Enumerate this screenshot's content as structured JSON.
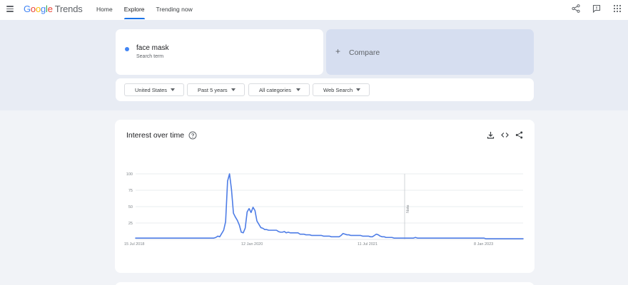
{
  "header": {
    "logo_google": "Google",
    "logo_product": "Trends",
    "nav": [
      {
        "label": "Home",
        "active": false
      },
      {
        "label": "Explore",
        "active": true
      },
      {
        "label": "Trending now",
        "active": false
      }
    ],
    "icons": [
      "share-icon",
      "feedback-icon",
      "apps-grid-icon"
    ]
  },
  "search": {
    "term": "face mask",
    "term_type": "Search term",
    "compare_label": "Compare",
    "term_color": "#4285f4"
  },
  "filters": [
    "United States",
    "Past 5 years",
    "All categories",
    "Web Search"
  ],
  "interest": {
    "title": "Interest over time",
    "actions": [
      "download-icon",
      "embed-icon",
      "share-icon"
    ],
    "note_label": "Note"
  },
  "chart_data": {
    "type": "line",
    "series": [
      {
        "values": [
          2,
          2,
          2,
          2,
          2,
          2,
          2,
          2,
          2,
          2,
          2,
          2,
          2,
          2,
          2,
          2,
          2,
          2,
          2,
          2,
          2,
          2,
          2,
          2,
          2,
          2,
          2,
          2,
          2,
          2,
          2,
          2,
          2,
          2,
          2,
          2,
          2,
          2,
          2,
          2,
          2,
          3,
          5,
          4,
          9,
          14,
          27,
          89,
          100,
          76,
          40,
          34,
          29,
          22,
          11,
          10,
          17,
          42,
          47,
          41,
          49,
          44,
          28,
          23,
          18,
          17,
          15,
          15,
          14,
          14,
          14,
          14,
          14,
          12,
          11,
          11,
          12,
          10,
          11,
          10,
          10,
          10,
          10,
          10,
          8,
          8,
          8,
          7,
          7,
          7,
          6,
          6,
          6,
          6,
          6,
          6,
          5,
          5,
          5,
          5,
          4,
          4,
          4,
          4,
          4,
          6,
          9,
          8,
          7,
          7,
          6,
          6,
          6,
          6,
          6,
          6,
          5,
          5,
          5,
          5,
          4,
          4,
          6,
          8,
          7,
          5,
          4,
          4,
          3,
          3,
          3,
          3,
          2,
          2,
          2,
          2,
          2,
          2,
          2,
          2,
          2,
          2,
          2,
          3,
          2,
          2,
          2,
          2,
          2,
          2,
          2,
          2,
          2,
          2,
          2,
          2,
          2,
          2,
          2,
          2,
          2,
          2,
          2,
          2,
          2,
          2,
          2,
          2,
          2,
          2,
          2,
          2,
          2,
          2,
          2,
          2,
          2,
          2,
          2,
          1,
          1,
          1,
          1,
          1,
          1,
          1,
          1,
          1,
          1,
          1,
          1,
          1,
          1,
          1,
          1,
          1,
          1,
          1,
          1
        ]
      }
    ],
    "x_tick_labels": [
      "15 Jul 2018",
      "12 Jan 2020",
      "11 Jul 2021",
      "8 Jan 2023"
    ],
    "y_tick_labels": [
      "100",
      "75",
      "50",
      "25"
    ],
    "ylim": [
      0,
      100
    ],
    "line_color": "#4e7de6",
    "grid": true
  }
}
